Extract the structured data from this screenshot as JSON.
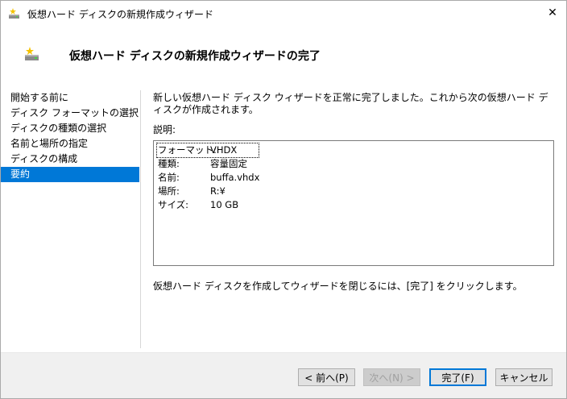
{
  "window": {
    "title": "仮想ハード ディスクの新規作成ウィザード",
    "close_glyph": "✕"
  },
  "header": {
    "title": "仮想ハード ディスクの新規作成ウィザードの完了"
  },
  "nav": {
    "items": [
      {
        "label": "開始する前に",
        "selected": false
      },
      {
        "label": "ディスク フォーマットの選択",
        "selected": false
      },
      {
        "label": "ディスクの種類の選択",
        "selected": false
      },
      {
        "label": "名前と場所の指定",
        "selected": false
      },
      {
        "label": "ディスクの構成",
        "selected": false
      },
      {
        "label": "要約",
        "selected": true
      }
    ]
  },
  "main": {
    "intro": "新しい仮想ハード ディスク ウィザードを正常に完了しました。これから次の仮想ハード ディスクが作成されます。",
    "description_label": "説明:",
    "summary": [
      {
        "key": "フォーマット:",
        "value": "VHDX"
      },
      {
        "key": "種類:",
        "value": "容量固定"
      },
      {
        "key": "名前:",
        "value": "buffa.vhdx"
      },
      {
        "key": "場所:",
        "value": "R:¥"
      },
      {
        "key": "サイズ:",
        "value": "10 GB"
      }
    ],
    "finish_note": "仮想ハード ディスクを作成してウィザードを閉じるには、[完了] をクリックします。"
  },
  "footer": {
    "back_label": "< 前へ(P)",
    "next_label": "次へ(N) >",
    "finish_label": "完了(F)",
    "cancel_label": "キャンセル"
  },
  "colors": {
    "accent": "#0078d7",
    "selected_text": "#ffffff",
    "footer_bg": "#f0f0f0"
  },
  "icons": {
    "title": "virtual-disk-icon",
    "header": "virtual-disk-icon",
    "close": "close-icon"
  }
}
